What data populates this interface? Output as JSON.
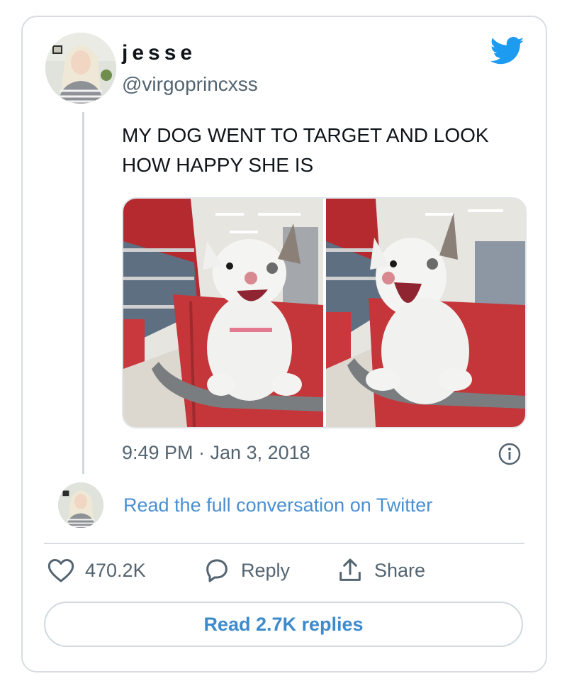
{
  "tweet": {
    "display_name": "jesse",
    "handle": "@virgoprincxss",
    "text": "MY DOG WENT TO TARGET AND LOOK HOW HAPPY SHE IS",
    "timestamp": "9:49 PM · Jan 3, 2018",
    "read_conversation": "Read the full conversation on Twitter"
  },
  "actions": {
    "likes": "470.2K",
    "reply_label": "Reply",
    "share_label": "Share"
  },
  "read_replies_label": "Read 2.7K replies",
  "icons": {
    "brand": "twitter-bird-icon",
    "info": "info-icon",
    "like": "heart-icon",
    "reply": "speech-bubble-icon",
    "share": "share-arrow-icon"
  },
  "colors": {
    "twitter_blue": "#1d9bf0",
    "link_blue": "#4a8fd0",
    "muted": "#536471",
    "border": "#d9dde1"
  }
}
